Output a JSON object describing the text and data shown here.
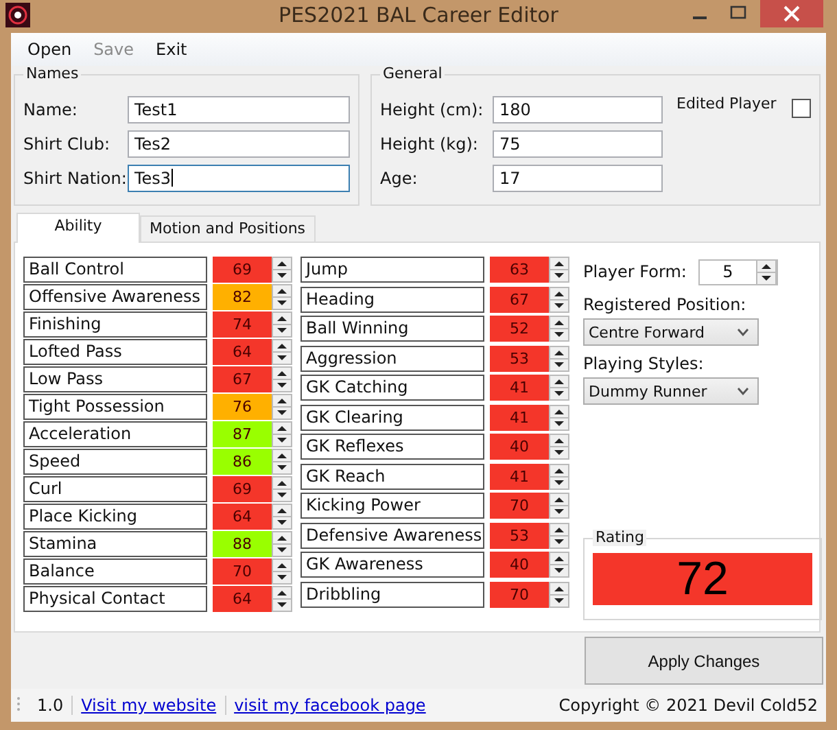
{
  "window": {
    "title": "PES2021 BAL Career Editor"
  },
  "menu": [
    {
      "label": "Open",
      "disabled": false
    },
    {
      "label": "Save",
      "disabled": true
    },
    {
      "label": "Exit",
      "disabled": false
    }
  ],
  "names": {
    "title": "Names",
    "fields": [
      {
        "label": "Name:",
        "value": "Test1",
        "focused": false
      },
      {
        "label": "Shirt Club:",
        "value": "Tes2",
        "focused": false
      },
      {
        "label": "Shirt Nation:",
        "value": "Tes3",
        "focused": true
      }
    ]
  },
  "general": {
    "title": "General",
    "fields": [
      {
        "label": "Height (cm):",
        "value": "180"
      },
      {
        "label": "Height (kg):",
        "value": "75"
      },
      {
        "label": "Age:",
        "value": "17"
      }
    ],
    "edited_player": {
      "label": "Edited Player",
      "checked": false
    }
  },
  "tabs": [
    {
      "label": "Ability",
      "selected": true
    },
    {
      "label": "Motion and Positions",
      "selected": false
    }
  ],
  "abilities_left": [
    {
      "name": "Ball Control",
      "value": "69",
      "color": "#f4362a"
    },
    {
      "name": "Offensive Awareness",
      "value": "82",
      "color": "#ffb000"
    },
    {
      "name": "Finishing",
      "value": "74",
      "color": "#f4362a"
    },
    {
      "name": "Lofted Pass",
      "value": "64",
      "color": "#f4362a"
    },
    {
      "name": "Low Pass",
      "value": "67",
      "color": "#f4362a"
    },
    {
      "name": "Tight Possession",
      "value": "76",
      "color": "#ffb000"
    },
    {
      "name": "Acceleration",
      "value": "87",
      "color": "#99ff00"
    },
    {
      "name": "Speed",
      "value": "86",
      "color": "#99ff00"
    },
    {
      "name": "Curl",
      "value": "69",
      "color": "#f4362a"
    },
    {
      "name": "Place Kicking",
      "value": "64",
      "color": "#f4362a"
    },
    {
      "name": "Stamina",
      "value": "88",
      "color": "#99ff00"
    },
    {
      "name": "Balance",
      "value": "70",
      "color": "#f4362a"
    },
    {
      "name": "Physical Contact",
      "value": "64",
      "color": "#f4362a"
    }
  ],
  "abilities_right": [
    {
      "name": "Jump",
      "value": "63",
      "color": "#f4362a"
    },
    {
      "name": "Heading",
      "value": "67",
      "color": "#f4362a"
    },
    {
      "name": "Ball Winning",
      "value": "52",
      "color": "#f4362a"
    },
    {
      "name": "Aggression",
      "value": "53",
      "color": "#f4362a"
    },
    {
      "name": "GK Catching",
      "value": "41",
      "color": "#f4362a"
    },
    {
      "name": "GK Clearing",
      "value": "41",
      "color": "#f4362a"
    },
    {
      "name": "GK Reflexes",
      "value": "40",
      "color": "#f4362a"
    },
    {
      "name": "GK Reach",
      "value": "41",
      "color": "#f4362a"
    },
    {
      "name": "Kicking Power",
      "value": "70",
      "color": "#f4362a"
    },
    {
      "name": "Defensive Awareness",
      "value": "53",
      "color": "#f4362a"
    },
    {
      "name": "GK Awareness",
      "value": "40",
      "color": "#f4362a"
    },
    {
      "name": "Dribbling",
      "value": "70",
      "color": "#f4362a"
    }
  ],
  "player_form": {
    "label": "Player Form:",
    "value": "5"
  },
  "registered_position": {
    "label": "Registered Position:",
    "value": "Centre Forward"
  },
  "playing_styles": {
    "label": "Playing Styles:",
    "value": "Dummy Runner"
  },
  "rating": {
    "title": "Rating",
    "value": "72",
    "color": "#f4362a"
  },
  "apply_button": "Apply Changes",
  "status_bar": {
    "version": "1.0",
    "links": [
      "Visit my website",
      "visit my facebook page"
    ],
    "copyright": "Copyright © 2021 Devil Cold52"
  }
}
